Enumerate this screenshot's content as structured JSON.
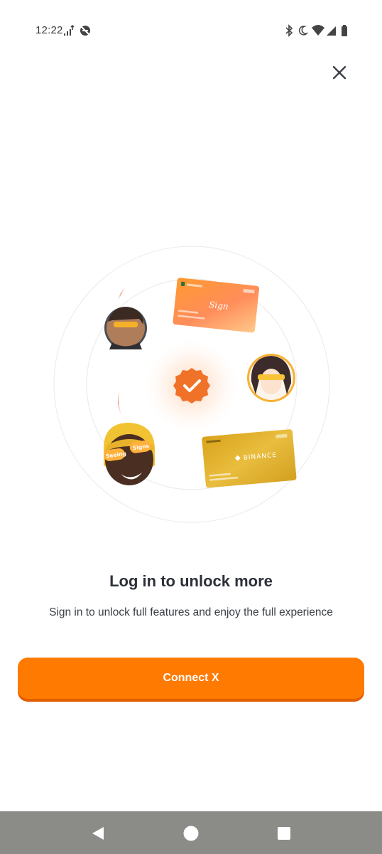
{
  "status_bar": {
    "time": "12:22",
    "icons": [
      "signal-activity-icon",
      "do-not-disturb-off-icon",
      "bluetooth-icon",
      "moon-icon",
      "wifi-icon",
      "cell-signal-icon",
      "battery-icon"
    ]
  },
  "header": {
    "close_icon": "close-icon"
  },
  "illustration": {
    "card_top": {
      "title": "Sign"
    },
    "card_bottom": {
      "brand": "BINANCE"
    },
    "avatar_glasses_text": [
      "Seeing",
      "Signs"
    ],
    "badge_icon": "check-badge-icon"
  },
  "content": {
    "title": "Log in to unlock more",
    "subtitle": "Sign in to unlock full features and enjoy the full experience",
    "button_label": "Connect X"
  },
  "colors": {
    "accent": "#ff7a00",
    "accent_shadow": "#e25e00",
    "nav_bar": "#8b8b87"
  },
  "nav_bar": {
    "icons": [
      "back-icon",
      "home-icon",
      "recents-icon"
    ]
  }
}
